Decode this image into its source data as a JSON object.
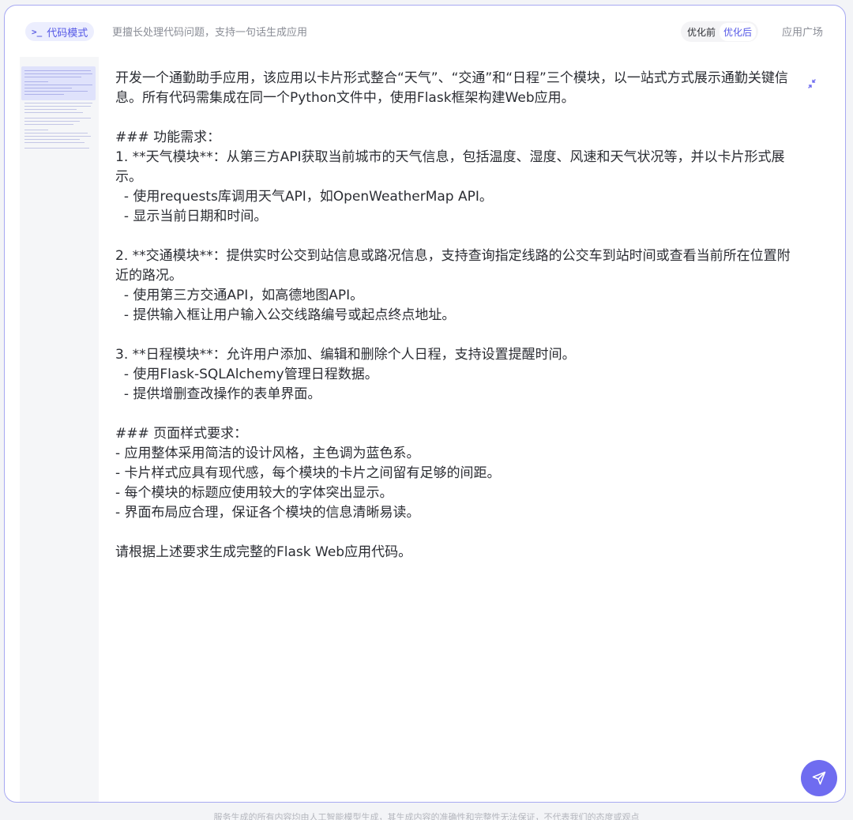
{
  "header": {
    "mode_icon_name": "terminal-prompt-icon",
    "mode_label": "代码模式",
    "subtitle": "更擅长处理代码问题，支持一句话生成应用",
    "opt_before": "优化前",
    "opt_after": "优化后",
    "opt_active": "优化后",
    "app_market": "应用广场"
  },
  "content": {
    "text": "开发一个通勤助手应用，该应用以卡片形式整合“天气”、“交通”和“日程”三个模块，以一站式方式展示通勤关键信息。所有代码需集成在同一个Python文件中，使用Flask框架构建Web应用。\n\n### 功能需求：\n1. **天气模块**：从第三方API获取当前城市的天气信息，包括温度、湿度、风速和天气状况等，并以卡片形式展示。\n  - 使用requests库调用天气API，如OpenWeatherMap API。\n  - 显示当前日期和时间。\n\n2. **交通模块**：提供实时公交到站信息或路况信息，支持查询指定线路的公交车到站时间或查看当前所在位置附近的路况。\n  - 使用第三方交通API，如高德地图API。\n  - 提供输入框让用户输入公交线路编号或起点终点地址。\n\n3. **日程模块**：允许用户添加、编辑和删除个人日程，支持设置提醒时间。\n  - 使用Flask-SQLAlchemy管理日程数据。\n  - 提供增删查改操作的表单界面。\n\n### 页面样式要求：\n- 应用整体采用简洁的设计风格，主色调为蓝色系。\n- 卡片样式应具有现代感，每个模块的卡片之间留有足够的间距。\n- 每个模块的标题应使用较大的字体突出显示。\n- 界面布局应合理，保证各个模块的信息清晰易读。\n\n请根据上述要求生成完整的Flask Web应用代码。"
  },
  "icons": {
    "collapse": "collapse-arrows-icon",
    "send": "send-paper-plane-icon"
  },
  "colors": {
    "accent": "#5558e6",
    "send_button": "#6f6cf0",
    "border": "#a7a9f2"
  },
  "footer": {
    "note": "服务生成的所有内容均由人工智能模型生成，其生成内容的准确性和完整性无法保证，不代表我们的态度或观点"
  }
}
